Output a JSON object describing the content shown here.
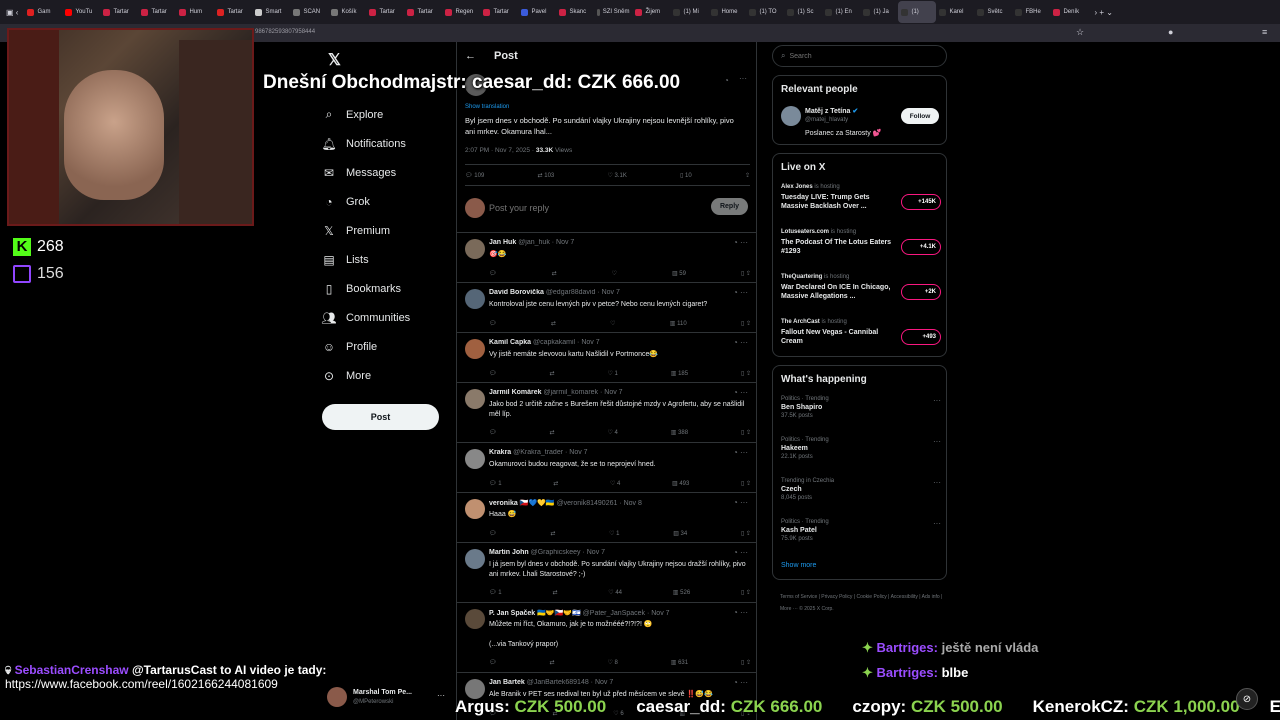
{
  "browser": {
    "tabs": [
      {
        "label": "Gam",
        "color": "#e02020"
      },
      {
        "label": "YouTu",
        "color": "#ff0000"
      },
      {
        "label": "Tartar",
        "color": "#cc2244"
      },
      {
        "label": "Tartar",
        "color": "#cc2244"
      },
      {
        "label": "Hum",
        "color": "#cc2244"
      },
      {
        "label": "Tartar",
        "color": "#dd2222"
      },
      {
        "label": "Smart",
        "color": "#cccccc"
      },
      {
        "label": "SCAN",
        "color": "#777777"
      },
      {
        "label": "Košík",
        "color": "#777777"
      },
      {
        "label": "Tartar",
        "color": "#cc2244"
      },
      {
        "label": "Tartar",
        "color": "#cc2244"
      },
      {
        "label": "Regen",
        "color": "#cc2244"
      },
      {
        "label": "Tartar",
        "color": "#cc2244"
      },
      {
        "label": "Pavel",
        "color": "#3b5bdb"
      },
      {
        "label": "Skanc",
        "color": "#cc2244"
      },
      {
        "label": "SZI Sněm",
        "color": "#555555"
      },
      {
        "label": "Žijem",
        "color": "#cc2244"
      },
      {
        "label": "(1) Mi",
        "color": "#333333"
      },
      {
        "label": "Home",
        "color": "#333333"
      },
      {
        "label": "(1) TO",
        "color": "#333333"
      },
      {
        "label": "(1) Sc",
        "color": "#333333"
      },
      {
        "label": "(1) En",
        "color": "#333333"
      },
      {
        "label": "(1) Ja",
        "color": "#333333"
      },
      {
        "label": "(1)",
        "color": "#333333"
      },
      {
        "label": "Karel",
        "color": "#333333"
      },
      {
        "label": "Světc",
        "color": "#333333"
      },
      {
        "label": "FBHe",
        "color": "#333333"
      },
      {
        "label": "Deník",
        "color": "#cc2244"
      }
    ],
    "url": "986782593807958444"
  },
  "stream": {
    "kick_viewers": "268",
    "twitch_viewers": "156",
    "overlay_title": "Dnešní Obchodmajstr: caesar_dd: CZK 666.00",
    "chat": [
      {
        "user": "SebastianCrenshaw",
        "text": "@TartarusCast to AI video je tady:",
        "user_color": "#9b4dff"
      },
      {
        "text": "https://www.facebook.com/reel/1602166244081609"
      },
      {
        "user": "Bartriges:",
        "text": "ještě není vláda",
        "user_color": "#9b4dff"
      },
      {
        "user": "Bartriges:",
        "text": "blbe",
        "user_color": "#9b4dff"
      }
    ],
    "ticker": [
      {
        "user": "Argus:",
        "amount": "CZK 500.00"
      },
      {
        "user": "caesar_dd:",
        "amount": "CZK 666.00"
      },
      {
        "user": "czopy:",
        "amount": "CZK 500.00"
      },
      {
        "user": "KenerokCZ:",
        "amount": "CZK 1,000.00"
      },
      {
        "user": "Ek",
        "amount": ""
      }
    ]
  },
  "nav": {
    "items": [
      "Explore",
      "Notifications",
      "Messages",
      "Grok",
      "Premium",
      "Lists",
      "Bookmarks",
      "Communities",
      "Profile",
      "More"
    ],
    "post_label": "Post",
    "account_name": "Marshal Tom Pe...",
    "account_handle": "@MPeterowski"
  },
  "center": {
    "header": "Post",
    "show_translation": "Show translation",
    "main_text": "Byl jsem dnes v obchodě. Po sundání vlajky Ukrajiny nejsou levnější rohlíky, pivo ani mrkev. Okamura lhal...",
    "meta_time": "2:07 PM · Nov 7, 2025 ·",
    "meta_views": "33.3K",
    "meta_views_label": "Views",
    "stats": {
      "replies": "109",
      "reposts": "103",
      "likes": "3.1K",
      "bookmarks": "10"
    },
    "reply_placeholder": "Post your reply",
    "reply_button": "Reply",
    "replies": [
      {
        "name": "Jan Huk",
        "handle": "@jan_huk · Nov 7",
        "text": "🎯😂",
        "replies": "",
        "reposts": "",
        "likes": "",
        "views": "59",
        "color": "#7a6a5a"
      },
      {
        "name": "David Borovička",
        "handle": "@edgar88david · Nov 7",
        "text": "Kontroloval jste cenu levných piv v petce? Nebo cenu levných cigaret?",
        "replies": "",
        "reposts": "",
        "likes": "",
        "views": "110",
        "color": "#556677"
      },
      {
        "name": "Kamil Čapka",
        "handle": "@capkakamil · Nov 7",
        "text": "Vy jistě nemáte slevovou kartu Našlidil v Portmonce😂",
        "replies": "",
        "reposts": "",
        "likes": "1",
        "views": "185",
        "color": "#a06040"
      },
      {
        "name": "Jarmil Komárek",
        "handle": "@jarmil_komarek · Nov 7",
        "text": "Jako bod 2 určitě začne s Burešem řešit důstojné mzdy v Agrofertu, aby se našlidil měl líp.",
        "replies": "",
        "reposts": "",
        "likes": "4",
        "views": "388",
        "color": "#8a7a6a"
      },
      {
        "name": "Krakra",
        "handle": "@Krakra_trader · Nov 7",
        "text": "Okamurovci budou reagovat, že se to neprojeví hned.",
        "replies": "1",
        "reposts": "",
        "likes": "4",
        "views": "493",
        "color": "#888888"
      },
      {
        "name": "veronika 🇨🇿💙💛🇺🇦",
        "handle": "@veronik81490261 · Nov 8",
        "text": "Haaa 😅",
        "replies": "",
        "reposts": "",
        "likes": "1",
        "views": "34",
        "color": "#c09070"
      },
      {
        "name": "Martin John",
        "handle": "@Graphicskeey · Nov 7",
        "text": "I já jsem byl dnes v obchodě. Po sundání vlajky Ukrajiny nejsou dražší rohlíky, pivo ani mrkev. Lhali Starostové? ;-)",
        "replies": "1",
        "reposts": "",
        "likes": "44",
        "views": "526",
        "color": "#6a7a8a"
      },
      {
        "name": "P. Jan Špaček 🇺🇦🤝🇨🇿🤝🇮🇱",
        "handle": "@Pater_JanSpacek · Nov 7",
        "text": "Můžete mi říct, Okamuro, jak je to možnééé?!?!?! 🙄\n\n(...via Tankový prapor)",
        "replies": "",
        "reposts": "",
        "likes": "8",
        "views": "631",
        "color": "#5a4a3a"
      },
      {
        "name": "Jan Bartek",
        "handle": "@JanBartek689148 · Nov 7",
        "text": "Ale Branik v PET ses nedival ten byl už před měsícem ve slevě ‼️😅😂",
        "replies": "",
        "reposts": "",
        "likes": "6",
        "views": "",
        "color": "#777777"
      }
    ]
  },
  "right": {
    "search_placeholder": "Search",
    "relevant_title": "Relevant people",
    "person_name": "Matěj z Tetína",
    "person_handle": "@matej_hlavaty",
    "person_bio": "Poslanec za Starosty 💕",
    "follow_label": "Follow",
    "live_title": "Live on X",
    "live": [
      {
        "host": "Alex Jones",
        "status": "is hosting",
        "title": "Tuesday LIVE: Trump Gets Massive Backlash Over ...",
        "count": "+145K"
      },
      {
        "host": "Lotuseaters.com",
        "status": "is hosting",
        "title": "The Podcast Of The Lotus Eaters #1293",
        "count": "+4.1K"
      },
      {
        "host": "TheQuartering",
        "status": "is hosting",
        "title": "War Declared On ICE In Chicago, Massive Allegations ...",
        "count": "+2K"
      },
      {
        "host": "The ArchCast",
        "status": "is hosting",
        "title": "Fallout New Vegas - Cannibal Cream",
        "count": "+493"
      }
    ],
    "happening_title": "What's happening",
    "trends": [
      {
        "ctx": "Politics · Trending",
        "name": "Ben Shapiro",
        "posts": "37.5K posts"
      },
      {
        "ctx": "Politics · Trending",
        "name": "Hakeem",
        "posts": "22.1K posts"
      },
      {
        "ctx": "Trending in Czechia",
        "name": "Czech",
        "posts": "8,045 posts"
      },
      {
        "ctx": "Politics · Trending",
        "name": "Kash Patel",
        "posts": "75.9K posts"
      }
    ],
    "show_more": "Show more",
    "footer": "Terms of Service | Privacy Policy | Cookie Policy | Accessibility | Ads info | More ··· © 2025 X Corp."
  }
}
